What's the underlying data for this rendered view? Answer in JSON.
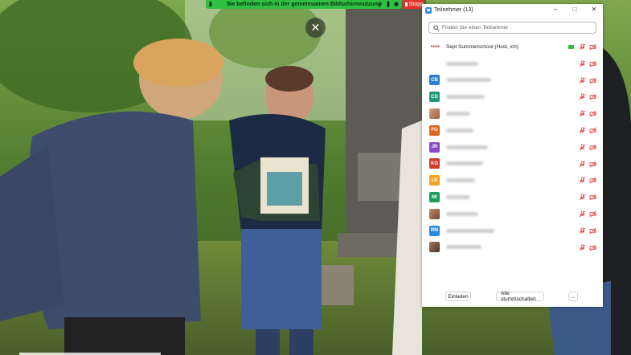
{
  "share_bar": {
    "text": "Sie befinden sich in der gemeinsamen Bildschirmnutzung",
    "stop_label": "Stopp"
  },
  "panel": {
    "title": "Teilnehmer (13)",
    "search_placeholder": "Finden Sie einen Teilnehmer",
    "participants": [
      {
        "initials": "",
        "name": "Sept Summerschool  (Host, ich)",
        "color": "",
        "sharing": true
      },
      {
        "initials": "",
        "name": "",
        "color": ""
      },
      {
        "initials": "CB",
        "name": "",
        "color": "#2a7fd6"
      },
      {
        "initials": "CD",
        "name": "",
        "color": "#1e9a7a"
      },
      {
        "initials": "",
        "name": "",
        "color": ""
      },
      {
        "initials": "FO",
        "name": "",
        "color": "#e0641e"
      },
      {
        "initials": "JR",
        "name": "",
        "color": "#8a48c6"
      },
      {
        "initials": "KG",
        "name": "",
        "color": "#d13b2c"
      },
      {
        "initials": "LK",
        "name": "",
        "color": "#f2a21e"
      },
      {
        "initials": "MI",
        "name": "",
        "color": "#1f9e5a"
      },
      {
        "initials": "",
        "name": "",
        "color": ""
      },
      {
        "initials": "RM",
        "name": "",
        "color": "#2b8ad8"
      },
      {
        "initials": "",
        "name": "",
        "color": ""
      }
    ],
    "invite_label": "Einladen",
    "mute_all_label": "Alle stummschalten",
    "more_label": "..."
  },
  "colors": {
    "share_green": "#2fc144",
    "stop_red": "#e0342b",
    "mute_red": "#e03b3b"
  }
}
